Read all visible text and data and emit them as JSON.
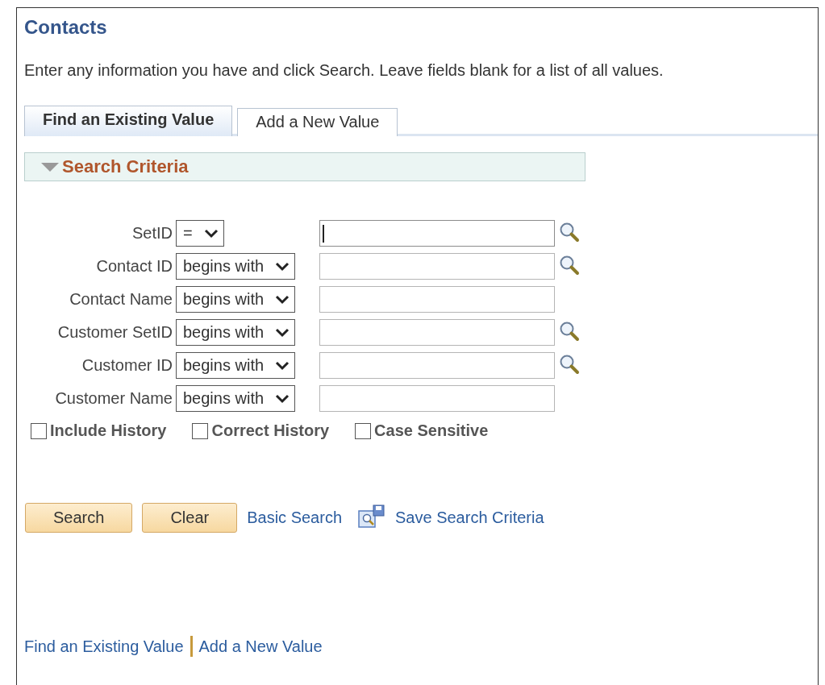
{
  "title": "Contacts",
  "instructions": "Enter any information you have and click Search. Leave fields blank for a list of all values.",
  "tabs": [
    {
      "label": "Find an Existing Value",
      "selected": true
    },
    {
      "label": "Add a New Value",
      "selected": false
    }
  ],
  "section": {
    "title": "Search Criteria",
    "expanded": true
  },
  "fields": [
    {
      "label": "SetID",
      "operator": "=",
      "focused": true,
      "lookup": true
    },
    {
      "label": "Contact ID",
      "operator": "begins with",
      "focused": false,
      "lookup": true
    },
    {
      "label": "Contact Name",
      "operator": "begins with",
      "focused": false,
      "lookup": false
    },
    {
      "label": "Customer SetID",
      "operator": "begins with",
      "focused": false,
      "lookup": true
    },
    {
      "label": "Customer ID",
      "operator": "begins with",
      "focused": false,
      "lookup": true
    },
    {
      "label": "Customer Name",
      "operator": "begins with",
      "focused": false,
      "lookup": false
    }
  ],
  "options": [
    {
      "label": "Include History",
      "checked": false
    },
    {
      "label": "Correct History",
      "checked": false
    },
    {
      "label": "Case Sensitive",
      "checked": false
    }
  ],
  "buttons": [
    "Search",
    "Clear"
  ],
  "links": [
    "Basic Search",
    "Save Search Criteria"
  ],
  "footer_links": [
    "Find an Existing Value",
    "Add a New Value"
  ]
}
